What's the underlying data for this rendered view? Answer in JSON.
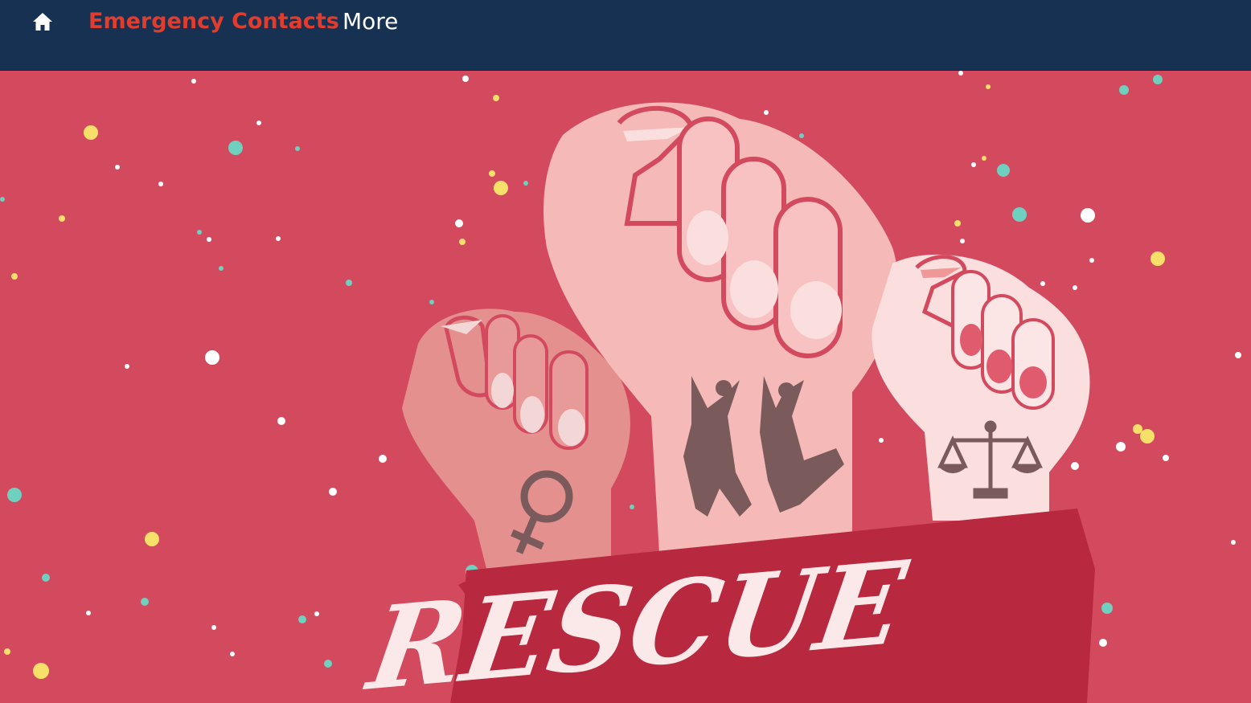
{
  "nav": {
    "home_icon": "home-icon",
    "items": [
      {
        "label": "Emergency Contacts",
        "active": true
      },
      {
        "label": "More",
        "active": false
      }
    ]
  },
  "hero": {
    "banner_text": "RESCUE",
    "icons": [
      "female-symbol-icon",
      "jumping-women-icon",
      "justice-scale-icon"
    ],
    "colors": {
      "background": "#d34a5e",
      "navbar": "#173153",
      "active_link": "#e03d2f",
      "banner": "#b8283f",
      "fist_left": "#e3908f",
      "fist_center": "#f5b9b8",
      "fist_right": "#fbdede",
      "tattoo": "#7a5a5a"
    }
  }
}
